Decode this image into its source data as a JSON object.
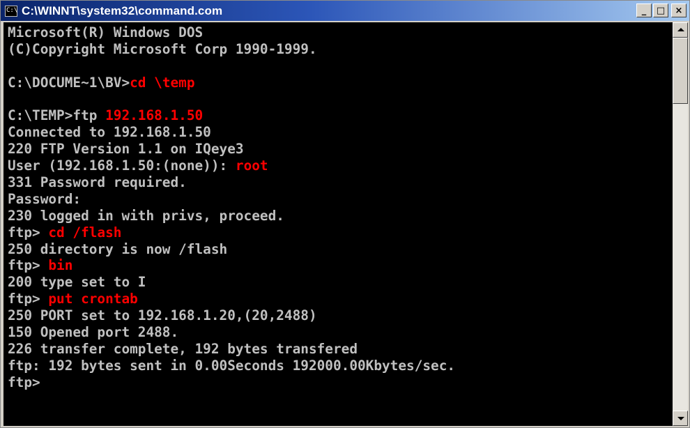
{
  "window": {
    "title": "C:\\WINNT\\system32\\command.com",
    "icon_text": "C:\\",
    "minimize_glyph": "_",
    "maximize_glyph": "□",
    "close_glyph": "×"
  },
  "console": {
    "text_color": "#c0c0c0",
    "command_color": "#ff0000",
    "background": "#000000",
    "lines": [
      {
        "text": "Microsoft(R) Windows DOS",
        "cmd": ""
      },
      {
        "text": "(C)Copyright Microsoft Corp 1990-1999.",
        "cmd": ""
      },
      {
        "text": "",
        "cmd": ""
      },
      {
        "text": "C:\\DOCUME~1\\BV>",
        "cmd": "cd \\temp"
      },
      {
        "text": "",
        "cmd": ""
      },
      {
        "text": "C:\\TEMP>ftp ",
        "cmd": "192.168.1.50"
      },
      {
        "text": "Connected to 192.168.1.50",
        "cmd": ""
      },
      {
        "text": "220 FTP Version 1.1 on IQeye3",
        "cmd": ""
      },
      {
        "text": "User (192.168.1.50:(none)): ",
        "cmd": "root"
      },
      {
        "text": "331 Password required.",
        "cmd": ""
      },
      {
        "text": "Password:",
        "cmd": ""
      },
      {
        "text": "230 logged in with privs, proceed.",
        "cmd": ""
      },
      {
        "text": "ftp> ",
        "cmd": "cd /flash"
      },
      {
        "text": "250 directory is now /flash",
        "cmd": ""
      },
      {
        "text": "ftp> ",
        "cmd": "bin"
      },
      {
        "text": "200 type set to I",
        "cmd": ""
      },
      {
        "text": "ftp> ",
        "cmd": "put crontab"
      },
      {
        "text": "250 PORT set to 192.168.1.20,(20,2488)",
        "cmd": ""
      },
      {
        "text": "150 Opened port 2488.",
        "cmd": ""
      },
      {
        "text": "226 transfer complete, 192 bytes transfered",
        "cmd": ""
      },
      {
        "text": "ftp: 192 bytes sent in 0.00Seconds 192000.00Kbytes/sec.",
        "cmd": ""
      },
      {
        "text": "ftp>",
        "cmd": ""
      }
    ]
  }
}
